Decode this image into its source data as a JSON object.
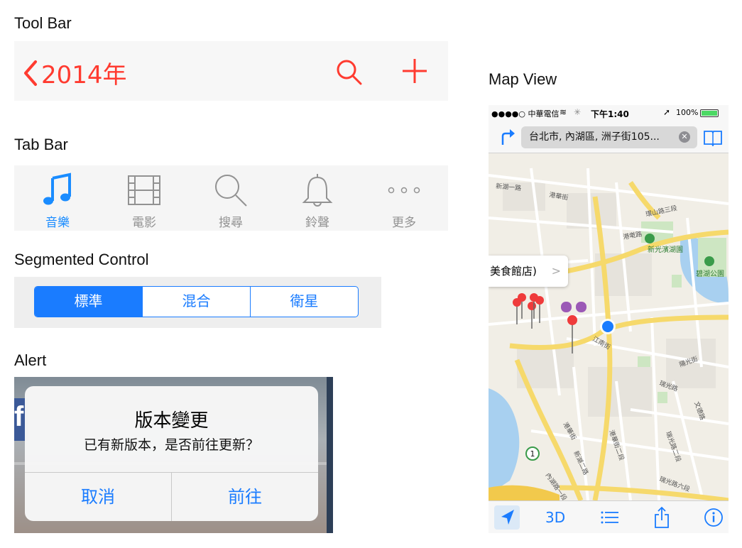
{
  "sections": {
    "toolbar_title": "Tool Bar",
    "tabbar_title": "Tab Bar",
    "segmented_title": "Segmented Control",
    "alert_title": "Alert",
    "mapview_title": "Map View"
  },
  "toolbar": {
    "back_label": "2014年",
    "accent_color": "#ff3b30"
  },
  "tabbar": {
    "tabs": [
      {
        "label": "音樂",
        "icon": "music-note-icon",
        "active": true
      },
      {
        "label": "電影",
        "icon": "film-icon",
        "active": false
      },
      {
        "label": "搜尋",
        "icon": "search-icon",
        "active": false
      },
      {
        "label": "鈴聲",
        "icon": "bell-icon",
        "active": false
      },
      {
        "label": "更多",
        "icon": "more-icon",
        "active": false
      }
    ],
    "active_color": "#1a8cff",
    "inactive_color": "#929292"
  },
  "segmented": {
    "items": [
      "標準",
      "混合",
      "衛星"
    ],
    "selected_index": 0,
    "tint_color": "#1a7cff"
  },
  "alert": {
    "title": "版本變更",
    "message": "已有新版本，是否前往更新？",
    "cancel_label": "取消",
    "confirm_label": "前往",
    "background_letter": "f"
  },
  "mapview": {
    "status": {
      "carrier": "●●●●○ 中華電信",
      "time": "下午1:40",
      "battery": "100%"
    },
    "search_text": "台北市, 內湖區, 洲子街105...",
    "callout_text": "美食館店)",
    "toolbar_3d_label": "3D",
    "map_labels": {
      "park1": "新光濱湖園",
      "park2": "碧湖公園",
      "road1": "環山路三段",
      "road2": "港墘路",
      "road3": "江南街",
      "road4": "瑞光路",
      "road5": "內湖路一段",
      "road6": "港華街",
      "road7": "瑞光路二段",
      "road8": "文德路",
      "road9": "港華街",
      "road10": "瑞光路六段",
      "road11": "陽光街",
      "road12": "港華街二段",
      "road13": "新湖一路",
      "road14": "新湖二路",
      "highway_shield": "1"
    }
  }
}
